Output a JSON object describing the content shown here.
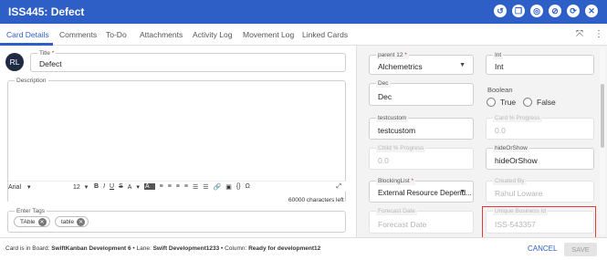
{
  "header": {
    "title": "ISS445:  Defect",
    "icons": [
      "history-icon",
      "copy-icon",
      "globe-icon",
      "no-entry-icon",
      "refresh-icon",
      "close-icon"
    ]
  },
  "tabs": [
    {
      "label": "Card Details",
      "active": true
    },
    {
      "label": "Comments"
    },
    {
      "label": "To-Do"
    },
    {
      "label": "Attachments"
    },
    {
      "label": "Activity Log"
    },
    {
      "label": "Movement Log"
    },
    {
      "label": "Linked Cards"
    }
  ],
  "left": {
    "avatar_initials": "RL",
    "title": {
      "label": "Title",
      "required": "*",
      "value": "Defect"
    },
    "description": {
      "label": "Description"
    },
    "toolbar": {
      "font": "Arial",
      "size": "12",
      "buttons": [
        "B",
        "I",
        "U",
        "S",
        "A",
        "A",
        "≡",
        "≡",
        "≡",
        "≡",
        "☰",
        "☰",
        "🔗",
        "▣",
        "{}",
        "Ω",
        "⤢"
      ]
    },
    "char_count": "60000 characters left",
    "tags": {
      "label": "Enter Tags",
      "items": [
        "TAble",
        "table"
      ]
    }
  },
  "right": {
    "parent12": {
      "label": "parent 12",
      "required": "*",
      "value": "Alchemetrics"
    },
    "int": {
      "label": "Int",
      "value": "Int"
    },
    "dec": {
      "label": "Dec",
      "value": "Dec"
    },
    "boolean": {
      "label": "Boolean",
      "options": [
        "True",
        "False"
      ]
    },
    "testcustom": {
      "label": "testcustom",
      "value": "testcustom"
    },
    "card_progress": {
      "label": "Card % Progress",
      "value": "0.0"
    },
    "child_progress": {
      "label": "Child % Progress",
      "value": "0.0"
    },
    "hide_or_show": {
      "label": "hideOrShow",
      "value": "hideOrShow"
    },
    "blocking_list": {
      "label": "BlockingList",
      "required": "*",
      "value": "External Resource Depend..."
    },
    "created_by": {
      "label": "Created By",
      "value": "Rahul Loware"
    },
    "forecast_date": {
      "label": "Forecast Date",
      "value": "Forecast Date"
    },
    "unique_business_id": {
      "label": "Unique Business Id",
      "value": "ISS-543357"
    }
  },
  "footer": {
    "board_prefix": "Card is in Board: ",
    "board": "SwiftKanban Development 6",
    "lane_prefix": "  •  Lane: ",
    "lane": "Swift Development1233",
    "column_prefix": "  •  Column: ",
    "column": "Ready for development12",
    "cancel_label": "CANCEL",
    "save_label": "SAVE"
  },
  "colors": {
    "accent": "#2d5fc7",
    "highlight": "#e53935",
    "pane": "#f3f3f3"
  }
}
